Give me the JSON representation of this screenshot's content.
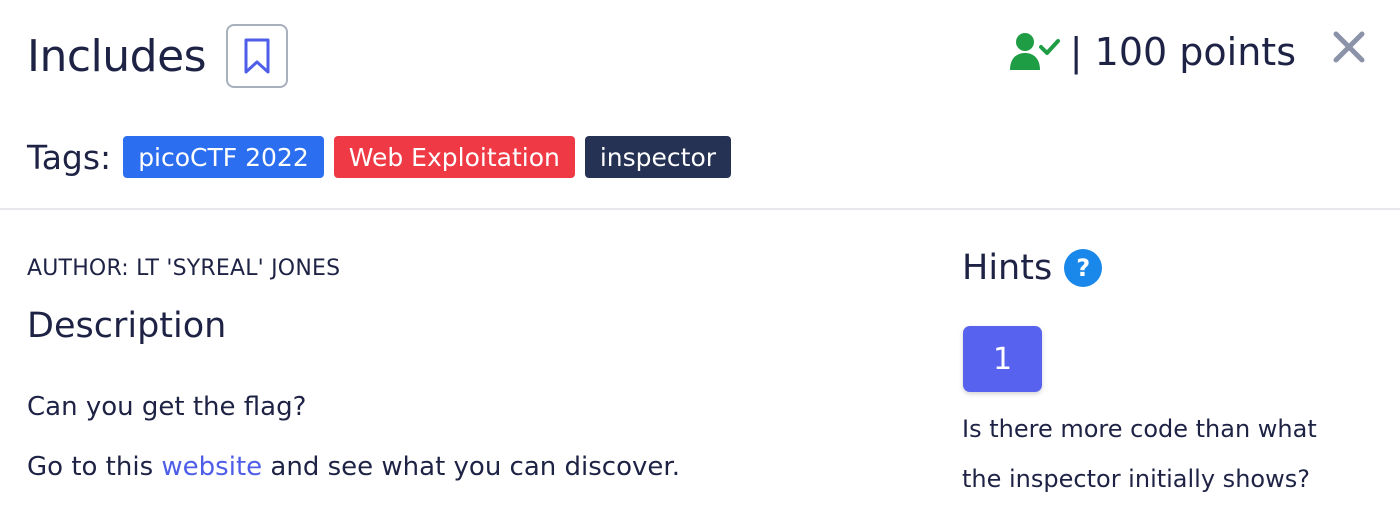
{
  "challenge": {
    "title": "Includes",
    "bookmark_icon": "bookmark-icon",
    "solved_icon": "user-check-icon",
    "points_text": "| 100 points",
    "close_icon": "close-icon"
  },
  "tags": {
    "label": "Tags:",
    "items": [
      {
        "label": "picoCTF 2022",
        "color": "#2b6ff0"
      },
      {
        "label": "Web Exploitation",
        "color": "#ef3a45"
      },
      {
        "label": "inspector",
        "color": "#253253"
      }
    ]
  },
  "description": {
    "author": "AUTHOR: LT 'SYREAL' JONES",
    "heading": "Description",
    "line1": "Can you get the flag?",
    "line2_prefix": "Go to this ",
    "line2_link": "website",
    "line2_suffix": " and see what you can discover."
  },
  "hints": {
    "heading": "Hints",
    "help_icon": "?",
    "button_label": "1",
    "text_line1": "Is there more code than what",
    "text_line2": "the inspector initially shows?"
  },
  "colors": {
    "solved_green": "#1f9d45",
    "link_blue": "#4e5ee8",
    "hint_button": "#5763ee",
    "help_blue": "#1a87ea"
  }
}
